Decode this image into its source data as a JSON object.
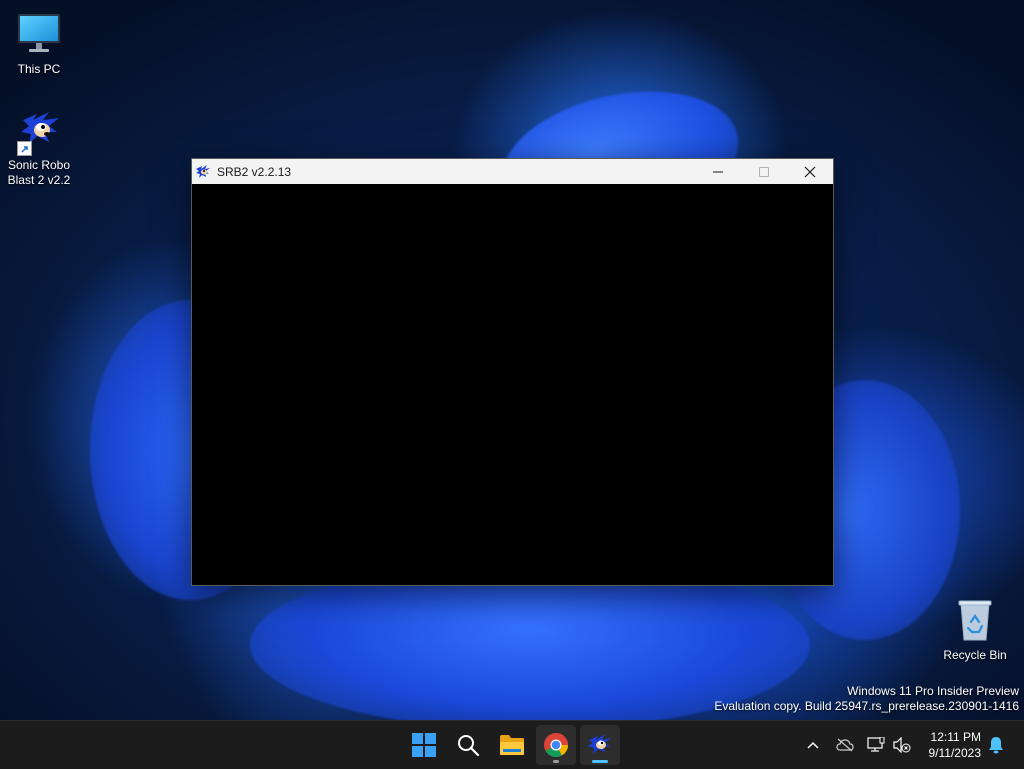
{
  "desktop": {
    "icons": [
      {
        "label": "This PC"
      },
      {
        "label_line1": "Sonic Robo",
        "label_line2": "Blast 2 v2.2"
      },
      {
        "label": "Recycle Bin"
      }
    ],
    "watermark": {
      "line1": "Windows 11 Pro Insider Preview",
      "line2": "Evaluation copy. Build 25947.rs_prerelease.230901-1416"
    }
  },
  "window": {
    "title": "SRB2 v2.2.13",
    "icon": "sonic-icon",
    "controls": [
      "minimize-icon",
      "maximize-icon",
      "close-icon"
    ]
  },
  "taskbar": {
    "pinned": [
      {
        "name": "start",
        "icon": "windows-logo-icon"
      },
      {
        "name": "search",
        "icon": "search-icon"
      },
      {
        "name": "file-explorer",
        "icon": "folder-icon"
      },
      {
        "name": "chrome",
        "icon": "chrome-icon"
      },
      {
        "name": "srb2",
        "icon": "sonic-icon"
      }
    ],
    "tray": {
      "icons": [
        "chevron-up-icon",
        "onedrive-offline-icon",
        "network-icon",
        "volume-muted-icon",
        "notification-bell-icon"
      ],
      "time": "12:11 PM",
      "date": "9/11/2023"
    }
  },
  "colors": {
    "accent": "#0078d4",
    "taskbar_bg": "#1c1c1c",
    "titlebar_bg": "#f3f3f3",
    "wallpaper_blue": "#1f5cff"
  }
}
